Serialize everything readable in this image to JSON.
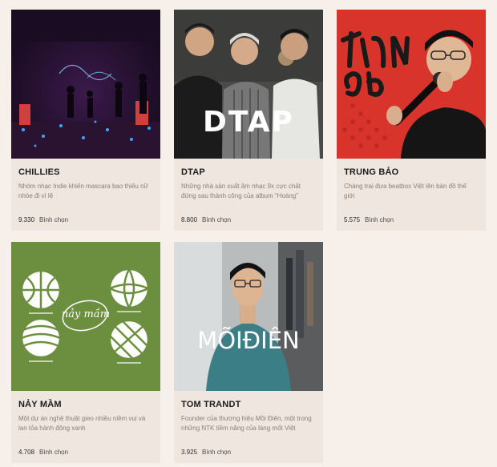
{
  "artists": [
    {
      "name": "CHILLIES",
      "description": "Nhóm nhạc Indie khiến mascara bao thiếu nữ nhòe đi vì lệ",
      "votes": "9.330",
      "vote_label": "Bình chọn",
      "image_icon": "concert-stage-photo"
    },
    {
      "name": "DTAP",
      "description": "Những nhà sản xuất âm nhạc 9x cực chất đứng sau thành công của album “Hoàng”",
      "votes": "8.800",
      "vote_label": "Bình chọn",
      "image_icon": "group-portrait-photo",
      "image_text": "DTAP"
    },
    {
      "name": "TRUNG BẢO",
      "description": "Chàng trai đưa beatbox Việt lên bản đồ thế giới",
      "votes": "5.575",
      "vote_label": "Bình chọn",
      "image_icon": "beatboxer-microphone-photo"
    },
    {
      "name": "NẢY MẦM",
      "description": "Một dự án nghệ thuật gieo nhiều niềm vui và lan tỏa hành động xanh",
      "votes": "4.708",
      "vote_label": "Bình chọn",
      "image_icon": "green-project-logo",
      "image_text": "nảy mầm"
    },
    {
      "name": "TOM TRANDT",
      "description": "Founder của thương hiệu Mồi Điên, một trong những NTK tiềm năng của làng mốt Việt",
      "votes": "3.925",
      "vote_label": "Bình chọn",
      "image_icon": "designer-portrait-photo",
      "image_text": "MÕIĐIÊN"
    }
  ],
  "colors": {
    "page_bg": "#f7f0ea",
    "card_bg": "#efe6df",
    "nay_mam_green": "#6b8f3e",
    "trung_bao_red": "#d9342b"
  }
}
